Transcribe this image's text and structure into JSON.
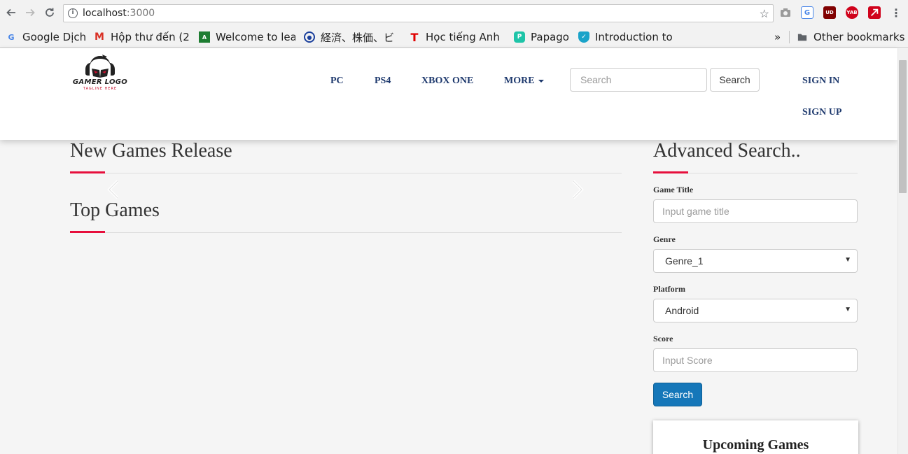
{
  "browser": {
    "url_host": "localhost",
    "url_port": ":3000",
    "extensions": [
      {
        "icon": "camera-icon"
      },
      {
        "icon": "google-translate-icon"
      },
      {
        "icon": "ublock-icon",
        "text": "UD"
      },
      {
        "icon": "yab-icon",
        "text": "YAB"
      },
      {
        "icon": "pdf-arrow-icon"
      },
      {
        "icon": "menu-dots-icon"
      }
    ],
    "bookmarks": [
      {
        "label": "Google Dịch",
        "icon": "google-translate-icon"
      },
      {
        "label": "Hộp thư đến (2",
        "icon": "gmail-icon"
      },
      {
        "label": "Welcome to lea",
        "icon": "code-icon"
      },
      {
        "label": "経済、株価、ビ",
        "icon": "globe-icon"
      },
      {
        "label": "Học tiếng Anh",
        "icon": "t-icon"
      },
      {
        "label": "Papago",
        "icon": "papago-icon"
      },
      {
        "label": "Introduction to",
        "icon": "shield-icon"
      }
    ],
    "overflow_label": "»",
    "other_bookmarks": "Other bookmarks"
  },
  "header": {
    "logo_text": "GAMER LOGO",
    "logo_tagline": "TAGLINE HERE",
    "nav": {
      "pc": "PC",
      "ps4": "PS4",
      "xbox": "XBOX ONE",
      "more": "MORE"
    },
    "search_placeholder": "Search",
    "search_button": "Search",
    "sign_in": "SIGN IN",
    "sign_up": "SIGN UP"
  },
  "main": {
    "new_games_title": "New Games Release",
    "top_games_title": "Top Games"
  },
  "sidebar": {
    "title": "Advanced Search..",
    "game_title_label": "Game Title",
    "game_title_placeholder": "Input game title",
    "genre_label": "Genre",
    "genre_value": "Genre_1",
    "platform_label": "Platform",
    "platform_value": "Android",
    "score_label": "Score",
    "score_placeholder": "Input Score",
    "search_button": "Search",
    "upcoming_title": "Upcoming Games"
  },
  "colors": {
    "accent": "#e60f3c",
    "nav_link": "#1f3a6e",
    "primary_button": "#1577b9"
  }
}
